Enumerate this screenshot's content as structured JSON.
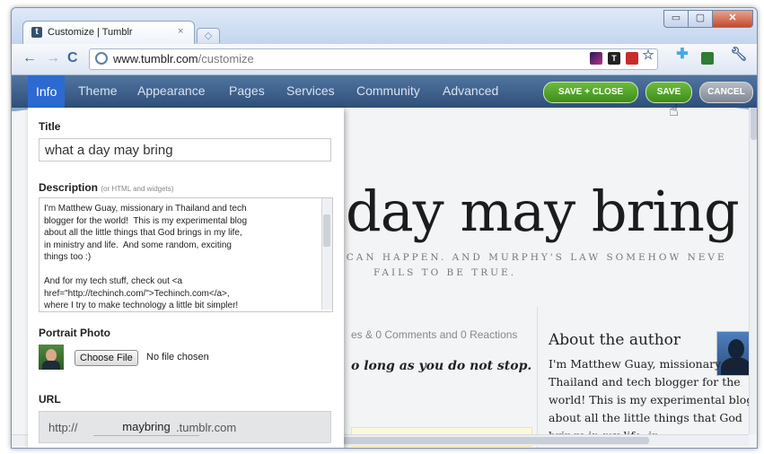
{
  "browser": {
    "tab_title": "Customize | Tumblr",
    "tab_favicon": "t",
    "tab_close": "×",
    "new_tab": "◇",
    "url_host": "www.tumblr.com",
    "url_path": "/customize",
    "controls": {
      "minimize": "▭",
      "maximize": "▢",
      "close": "✕"
    },
    "nav": {
      "back": "←",
      "forward": "→",
      "reload": "C"
    },
    "extension_icons": [
      "pen-icon",
      "t-icon",
      "red-square-icon",
      "star-icon",
      "puzzle-icon",
      "green-square-icon",
      "wrench-icon"
    ]
  },
  "customize_nav": {
    "tabs": [
      "Info",
      "Theme",
      "Appearance",
      "Pages",
      "Services",
      "Community",
      "Advanced"
    ],
    "active_tab": "Info",
    "buttons": {
      "save_close": "SAVE + CLOSE",
      "save": "SAVE",
      "cancel": "CANCEL"
    }
  },
  "panel": {
    "title_label": "Title",
    "title_value": "what a day may bring",
    "description_label": "Description",
    "description_hint": "(or HTML and widgets)",
    "description_value": "I'm Matthew Guay, missionary in Thailand and tech\nblogger for the world!  This is my experimental blog\nabout all the little things that God brings in my life,\nin ministry and life.  And some random, exciting\nthings too :)\n\nAnd for my tech stuff, check out <a\nhref=\"http://techinch.com/\">Techinch.com</a>,\nwhere I try to make technology a little bit simpler!",
    "portrait_label": "Portrait Photo",
    "choose_file": "Choose File",
    "no_file": "No file chosen",
    "url_label": "URL",
    "url_prefix": "http://",
    "url_subdomain": "maybring",
    "url_domain": ".tumblr.com"
  },
  "blog": {
    "title_visible": "day may bring",
    "tagline_line1": "G CAN HAPPEN. AND MURPHY'S LAW SOMEHOW NEVE",
    "tagline_line2": "FAILS TO BE TRUE.",
    "post_meta": "es & 0 Comments and 0 Reactions",
    "post_quote": "o long as you do not stop.",
    "about_heading": "About the author",
    "about_text": "I'm Matthew Guay, missionary in Thailand and tech blogger for the world! This is my experimental blog about all the little things that God brings in my life, in"
  },
  "colors": {
    "active_tab": "#2c6ad1",
    "save_green": "#4f9e26",
    "cancel_gray": "#9aa1ab",
    "nav_bar": "#3e6290"
  }
}
